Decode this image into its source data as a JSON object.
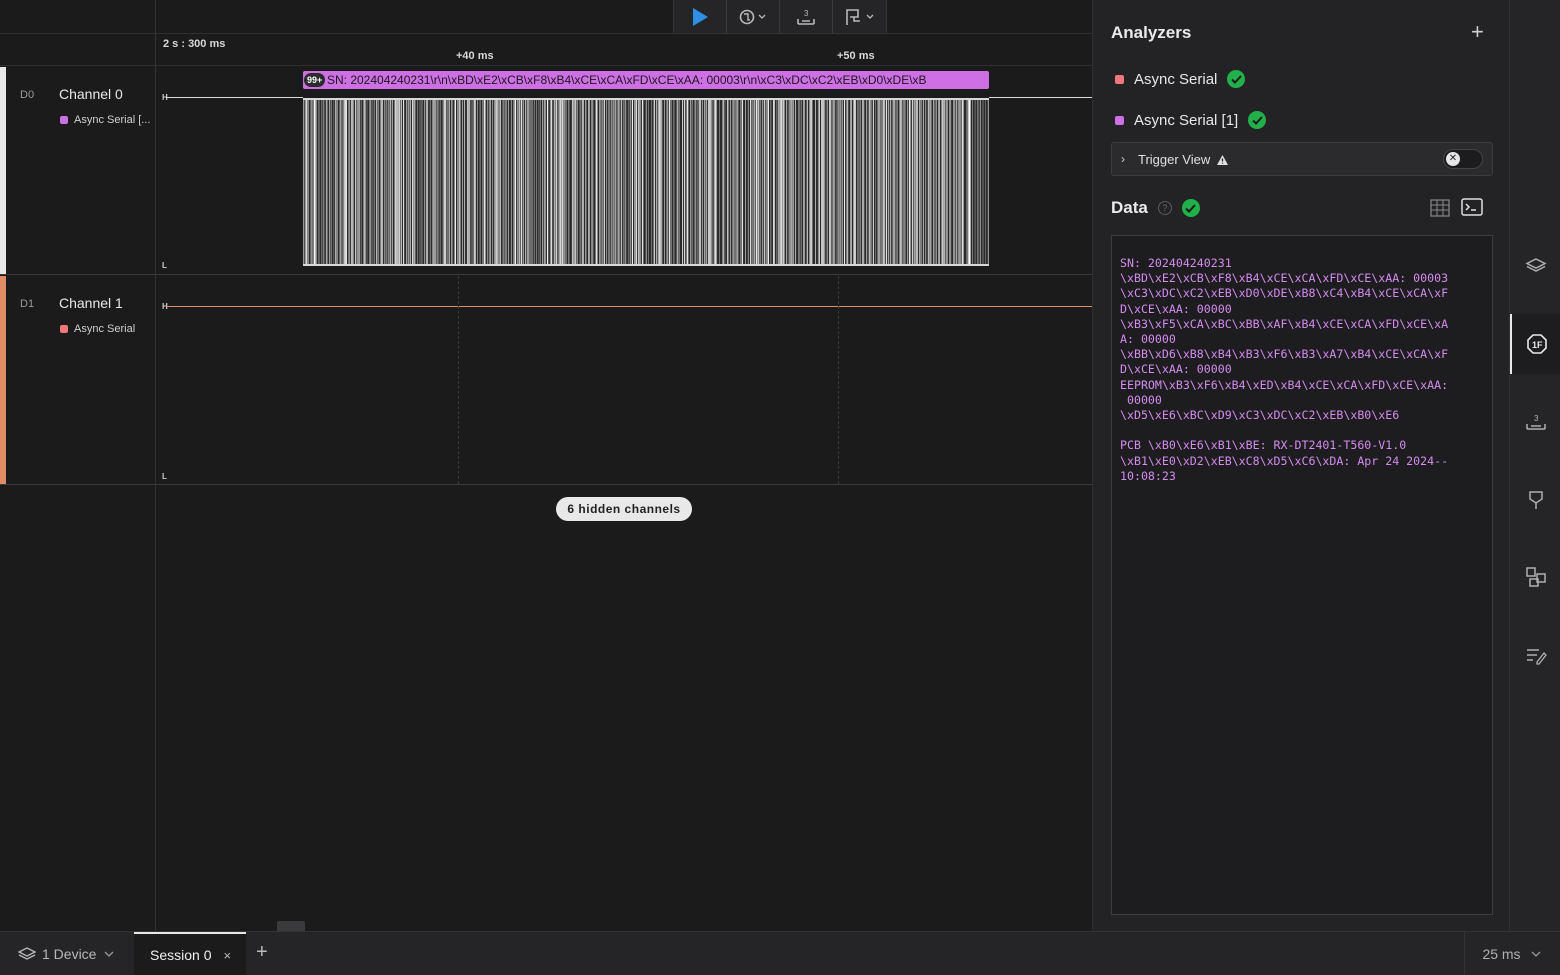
{
  "toolbar": {
    "play": "play-icon",
    "trigger": "trigger-icon",
    "measure": "measure-icon",
    "marker": "marker-icon"
  },
  "ruler": {
    "origin": "2 s : 300 ms",
    "tick1": "+40 ms",
    "tick2": "+50 ms"
  },
  "channels": [
    {
      "id": "D0",
      "name": "Channel 0",
      "analyzer": "Async Serial [...",
      "color": "#e8e8e8",
      "analyzer_color": "#cf6fe6",
      "high": "H",
      "low": "L"
    },
    {
      "id": "D1",
      "name": "Channel 1",
      "analyzer": "Async Serial",
      "color": "#e08c66",
      "analyzer_color": "#f07878",
      "high": "H",
      "low": "L"
    }
  ],
  "decode": {
    "badge": "99+",
    "text": "SN: 202404240231\\r\\n\\xBD\\xE2\\xCB\\xF8\\xB4\\xCE\\xCA\\xFD\\xCE\\xAA: 00003\\r\\n\\xC3\\xDC\\xC2\\xEB\\xD0\\xDE\\xB"
  },
  "hidden_channels": "6 hidden channels",
  "panel": {
    "analyzers_title": "Analyzers",
    "add": "+",
    "analyzers": [
      {
        "name": "Async Serial",
        "color": "#f07878"
      },
      {
        "name": "Async Serial [1]",
        "color": "#cf6fe6"
      }
    ],
    "trigger_view": "Trigger View",
    "data_title": "Data",
    "help": "?",
    "terminal": "SN: 202404240231\n\\xBD\\xE2\\xCB\\xF8\\xB4\\xCE\\xCA\\xFD\\xCE\\xAA: 00003\n\\xC3\\xDC\\xC2\\xEB\\xD0\\xDE\\xB8\\xC4\\xB4\\xCE\\xCA\\xF\nD\\xCE\\xAA: 00000\n\\xB3\\xF5\\xCA\\xBC\\xBB\\xAF\\xB4\\xCE\\xCA\\xFD\\xCE\\xA\nA: 00000\n\\xBB\\xD6\\xB8\\xB4\\xB3\\xF6\\xB3\\xA7\\xB4\\xCE\\xCA\\xF\nD\\xCE\\xAA: 00000\nEEPROM\\xB3\\xF6\\xB4\\xED\\xB4\\xCE\\xCA\\xFD\\xCE\\xAA:\n 00000\n\\xD5\\xE6\\xBC\\xD9\\xC3\\xDC\\xC2\\xEB\\xB0\\xE6\n\nPCB \\xB0\\xE6\\xB1\\xBE: RX-DT2401-T560-V1.0\n\\xB1\\xE0\\xD2\\xEB\\xC8\\xD5\\xC6\\xDA: Apr 24 2024--\n10:08:23"
  },
  "bottom": {
    "device": "1 Device",
    "session": "Session 0",
    "close": "×",
    "add": "+",
    "zoom": "25 ms"
  },
  "colors": {
    "accent": "#2f8fe6",
    "success": "#22b04b",
    "decode": "#cf6fe6"
  }
}
